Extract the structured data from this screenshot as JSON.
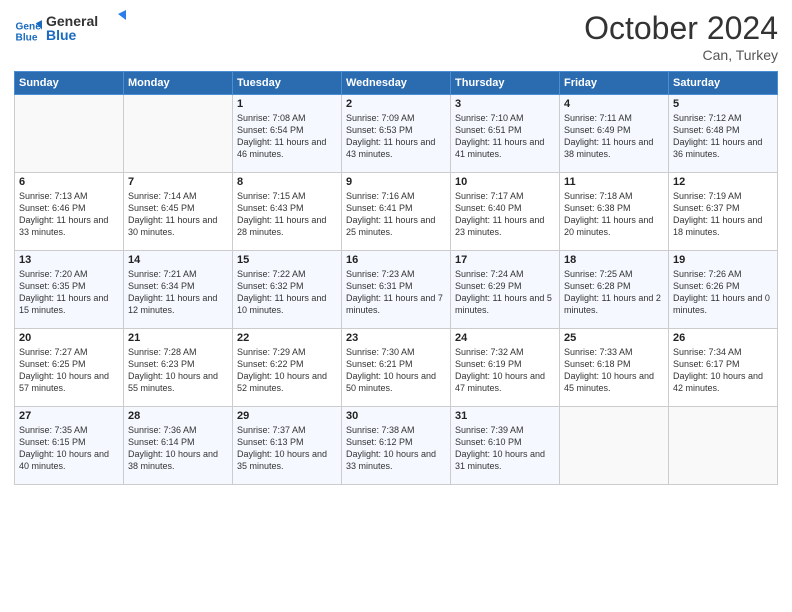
{
  "logo": {
    "line1": "General",
    "line2": "Blue"
  },
  "header": {
    "month": "October 2024",
    "location": "Can, Turkey"
  },
  "weekdays": [
    "Sunday",
    "Monday",
    "Tuesday",
    "Wednesday",
    "Thursday",
    "Friday",
    "Saturday"
  ],
  "weeks": [
    [
      {
        "day": "",
        "info": ""
      },
      {
        "day": "",
        "info": ""
      },
      {
        "day": "1",
        "info": "Sunrise: 7:08 AM\nSunset: 6:54 PM\nDaylight: 11 hours and 46 minutes."
      },
      {
        "day": "2",
        "info": "Sunrise: 7:09 AM\nSunset: 6:53 PM\nDaylight: 11 hours and 43 minutes."
      },
      {
        "day": "3",
        "info": "Sunrise: 7:10 AM\nSunset: 6:51 PM\nDaylight: 11 hours and 41 minutes."
      },
      {
        "day": "4",
        "info": "Sunrise: 7:11 AM\nSunset: 6:49 PM\nDaylight: 11 hours and 38 minutes."
      },
      {
        "day": "5",
        "info": "Sunrise: 7:12 AM\nSunset: 6:48 PM\nDaylight: 11 hours and 36 minutes."
      }
    ],
    [
      {
        "day": "6",
        "info": "Sunrise: 7:13 AM\nSunset: 6:46 PM\nDaylight: 11 hours and 33 minutes."
      },
      {
        "day": "7",
        "info": "Sunrise: 7:14 AM\nSunset: 6:45 PM\nDaylight: 11 hours and 30 minutes."
      },
      {
        "day": "8",
        "info": "Sunrise: 7:15 AM\nSunset: 6:43 PM\nDaylight: 11 hours and 28 minutes."
      },
      {
        "day": "9",
        "info": "Sunrise: 7:16 AM\nSunset: 6:41 PM\nDaylight: 11 hours and 25 minutes."
      },
      {
        "day": "10",
        "info": "Sunrise: 7:17 AM\nSunset: 6:40 PM\nDaylight: 11 hours and 23 minutes."
      },
      {
        "day": "11",
        "info": "Sunrise: 7:18 AM\nSunset: 6:38 PM\nDaylight: 11 hours and 20 minutes."
      },
      {
        "day": "12",
        "info": "Sunrise: 7:19 AM\nSunset: 6:37 PM\nDaylight: 11 hours and 18 minutes."
      }
    ],
    [
      {
        "day": "13",
        "info": "Sunrise: 7:20 AM\nSunset: 6:35 PM\nDaylight: 11 hours and 15 minutes."
      },
      {
        "day": "14",
        "info": "Sunrise: 7:21 AM\nSunset: 6:34 PM\nDaylight: 11 hours and 12 minutes."
      },
      {
        "day": "15",
        "info": "Sunrise: 7:22 AM\nSunset: 6:32 PM\nDaylight: 11 hours and 10 minutes."
      },
      {
        "day": "16",
        "info": "Sunrise: 7:23 AM\nSunset: 6:31 PM\nDaylight: 11 hours and 7 minutes."
      },
      {
        "day": "17",
        "info": "Sunrise: 7:24 AM\nSunset: 6:29 PM\nDaylight: 11 hours and 5 minutes."
      },
      {
        "day": "18",
        "info": "Sunrise: 7:25 AM\nSunset: 6:28 PM\nDaylight: 11 hours and 2 minutes."
      },
      {
        "day": "19",
        "info": "Sunrise: 7:26 AM\nSunset: 6:26 PM\nDaylight: 11 hours and 0 minutes."
      }
    ],
    [
      {
        "day": "20",
        "info": "Sunrise: 7:27 AM\nSunset: 6:25 PM\nDaylight: 10 hours and 57 minutes."
      },
      {
        "day": "21",
        "info": "Sunrise: 7:28 AM\nSunset: 6:23 PM\nDaylight: 10 hours and 55 minutes."
      },
      {
        "day": "22",
        "info": "Sunrise: 7:29 AM\nSunset: 6:22 PM\nDaylight: 10 hours and 52 minutes."
      },
      {
        "day": "23",
        "info": "Sunrise: 7:30 AM\nSunset: 6:21 PM\nDaylight: 10 hours and 50 minutes."
      },
      {
        "day": "24",
        "info": "Sunrise: 7:32 AM\nSunset: 6:19 PM\nDaylight: 10 hours and 47 minutes."
      },
      {
        "day": "25",
        "info": "Sunrise: 7:33 AM\nSunset: 6:18 PM\nDaylight: 10 hours and 45 minutes."
      },
      {
        "day": "26",
        "info": "Sunrise: 7:34 AM\nSunset: 6:17 PM\nDaylight: 10 hours and 42 minutes."
      }
    ],
    [
      {
        "day": "27",
        "info": "Sunrise: 7:35 AM\nSunset: 6:15 PM\nDaylight: 10 hours and 40 minutes."
      },
      {
        "day": "28",
        "info": "Sunrise: 7:36 AM\nSunset: 6:14 PM\nDaylight: 10 hours and 38 minutes."
      },
      {
        "day": "29",
        "info": "Sunrise: 7:37 AM\nSunset: 6:13 PM\nDaylight: 10 hours and 35 minutes."
      },
      {
        "day": "30",
        "info": "Sunrise: 7:38 AM\nSunset: 6:12 PM\nDaylight: 10 hours and 33 minutes."
      },
      {
        "day": "31",
        "info": "Sunrise: 7:39 AM\nSunset: 6:10 PM\nDaylight: 10 hours and 31 minutes."
      },
      {
        "day": "",
        "info": ""
      },
      {
        "day": "",
        "info": ""
      }
    ]
  ]
}
